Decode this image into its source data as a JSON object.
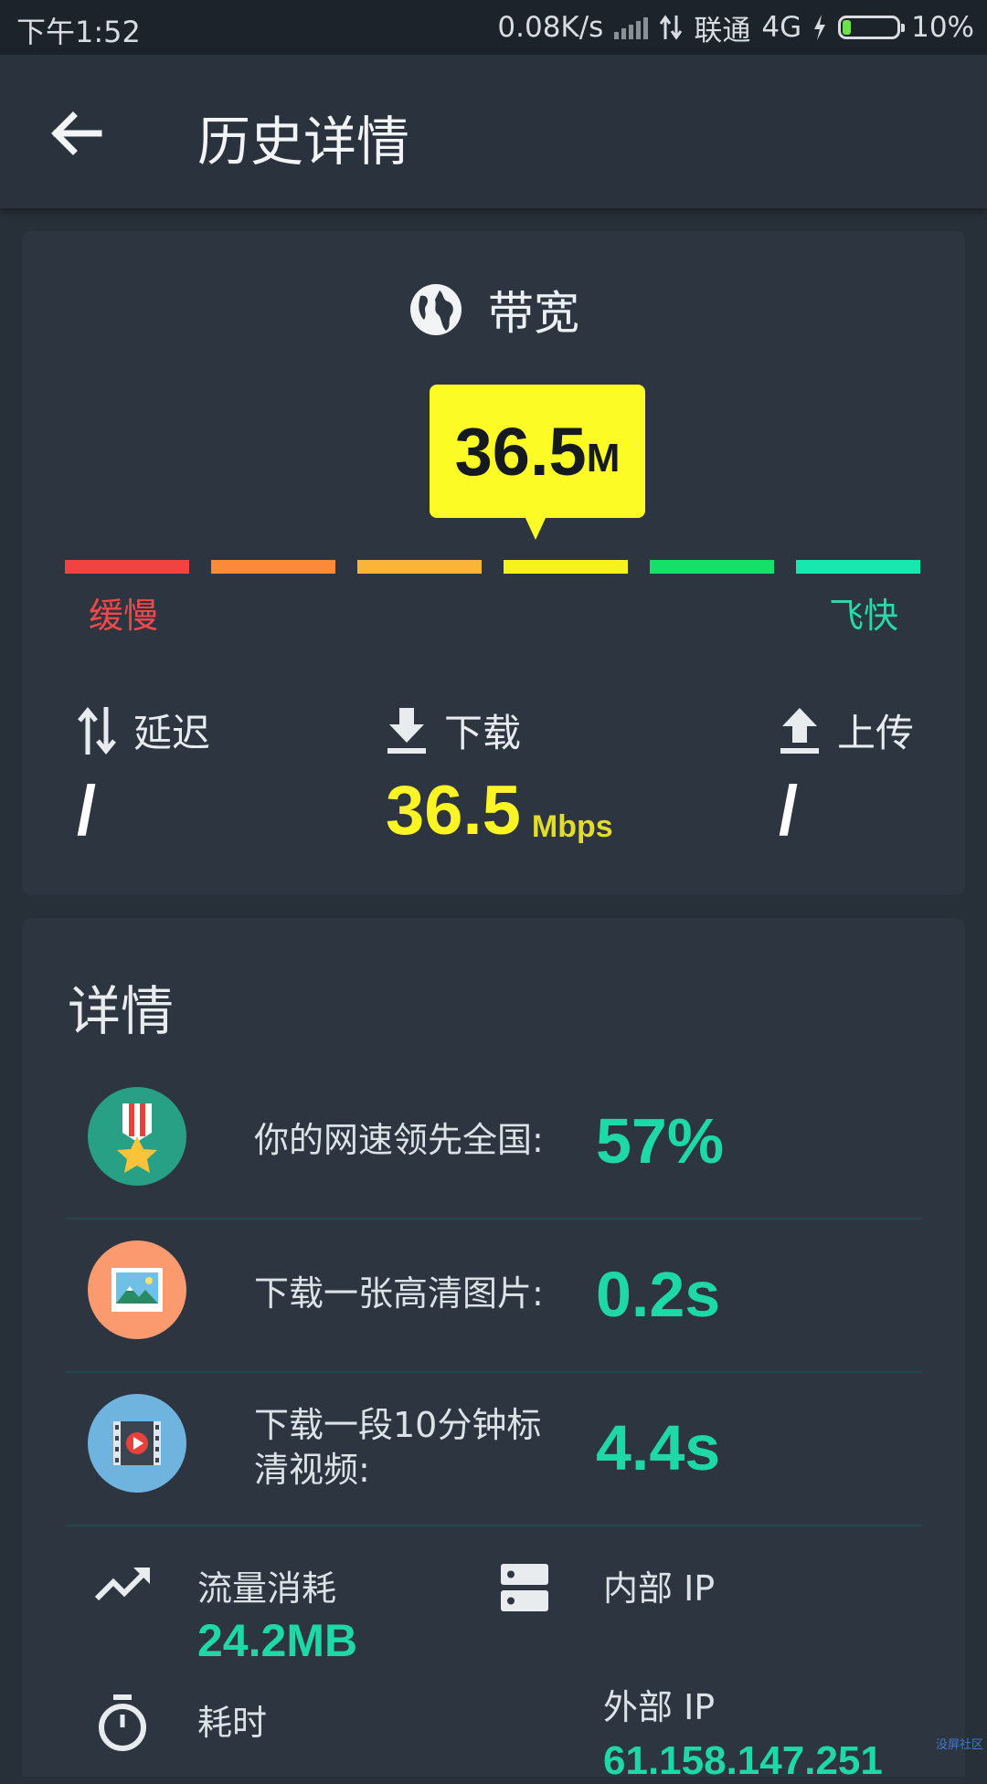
{
  "status_bar": {
    "time": "下午1:52",
    "speed": "0.08K/s",
    "carrier": "联通",
    "network": "4G",
    "battery": "10%"
  },
  "app_bar": {
    "title": "历史详情"
  },
  "bandwidth": {
    "label": "带宽",
    "value": "36.5",
    "unit": "M",
    "scale_slow": "缓慢",
    "scale_fast": "飞快",
    "scale_colors": [
      "#f24343",
      "#fb8a3a",
      "#fbb43a",
      "#f7f21e",
      "#16e069",
      "#16e8b0"
    ]
  },
  "metrics": {
    "latency": {
      "label": "延迟",
      "value": "/"
    },
    "download": {
      "label": "下载",
      "value": "36.5",
      "unit": "Mbps"
    },
    "upload": {
      "label": "上传",
      "value": "/"
    }
  },
  "details": {
    "title": "详情",
    "rows": [
      {
        "label": "你的网速领先全国:",
        "value": "57%",
        "icon": "medal-icon"
      },
      {
        "label": "下载一张高清图片:",
        "value": "0.2s",
        "icon": "picture-icon"
      },
      {
        "label": "下载一段10分钟标清视频:",
        "value": "4.4s",
        "icon": "video-icon"
      }
    ],
    "traffic": {
      "label": "流量消耗",
      "value": "24.2MB"
    },
    "duration": {
      "label": "耗时"
    },
    "internal_ip": {
      "label": "内部 IP"
    },
    "external_ip": {
      "label": "外部 IP",
      "value": "61.158.147.251"
    }
  },
  "watermark": "没屏社区"
}
